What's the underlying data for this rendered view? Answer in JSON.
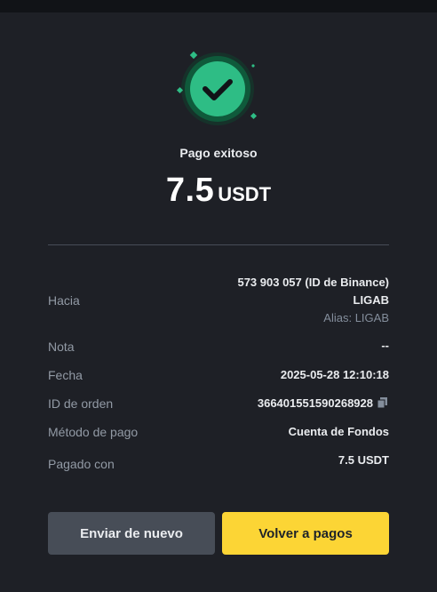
{
  "status": {
    "title": "Pago exitoso",
    "amount": "7.5",
    "currency": "USDT"
  },
  "details": {
    "to_label": "Hacia",
    "to_id": "573 903 057 (ID de Binance)",
    "to_name": "LIGAB",
    "to_alias": "Alias: LIGAB",
    "note_label": "Nota",
    "note_value": "--",
    "date_label": "Fecha",
    "date_value": "2025-05-28 12:10:18",
    "order_label": "ID de orden",
    "order_value": "366401551590268928",
    "method_label": "Método de pago",
    "method_value": "Cuenta de Fondos",
    "paid_label": "Pagado con",
    "paid_value": "7.5 USDT"
  },
  "actions": {
    "send_again": "Enviar de nuevo",
    "back": "Volver a pagos"
  },
  "colors": {
    "background": "#1e2026",
    "success_green": "#2ebd85",
    "primary_yellow": "#fcd535",
    "secondary_gray": "#474d57"
  },
  "icons": {
    "status": "check-circle-icon",
    "copy": "copy-icon"
  }
}
